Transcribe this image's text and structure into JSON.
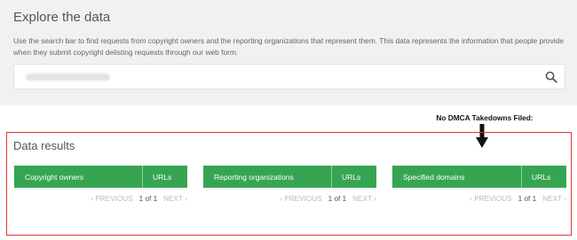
{
  "header": {
    "title": "Explore the data",
    "description": "Use the search bar to find requests from copyright owners and the reporting organizations that represent them. This data represents the information that people provide when they submit copyright delisting requests through our web form."
  },
  "annotation": {
    "text": "No DMCA Takedowns Filed:"
  },
  "results": {
    "title": "Data results",
    "cards": [
      {
        "label": "Copyright owners",
        "urls_label": "URLs",
        "prev": "PREVIOUS",
        "page": "1 of 1",
        "next": "NEXT"
      },
      {
        "label": "Reporting organizations",
        "urls_label": "URLs",
        "prev": "PREVIOUS",
        "page": "1 of 1",
        "next": "NEXT"
      },
      {
        "label": "Specified domains",
        "urls_label": "URLs",
        "prev": "PREVIOUS",
        "page": "1 of 1",
        "next": "NEXT"
      }
    ]
  },
  "colors": {
    "bar": "#36a552",
    "highlight_border": "#e03535",
    "top_background": "#f1f1f1"
  },
  "icons": {
    "search": "search-icon",
    "arrow": "arrow-down-icon",
    "prev": "chevron-left-icon",
    "next": "chevron-right-icon"
  }
}
